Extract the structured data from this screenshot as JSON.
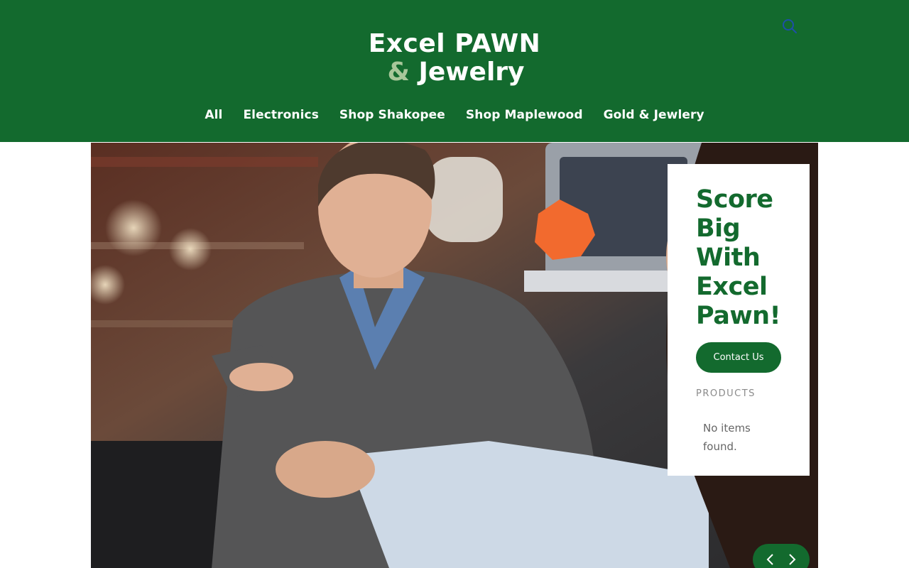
{
  "brand": {
    "logo_line1": "Excel PAWN",
    "logo_amp": "&",
    "logo_line2": "Jewelry",
    "primary_color": "#136a2e",
    "accent_color": "#a8c79a"
  },
  "header": {
    "search_icon": "search-icon"
  },
  "nav": {
    "items": [
      {
        "label": "All"
      },
      {
        "label": "Electronics"
      },
      {
        "label": "Shop Shakopee"
      },
      {
        "label": "Shop Maplewood"
      },
      {
        "label": "Gold & Jewlery"
      }
    ]
  },
  "hero": {
    "image": "photo of a man at a pawn shop counter being helped by a woman",
    "card": {
      "title": "Score Big With Excel Pawn!",
      "button_label": "Contact Us",
      "products_label": "PRODUCTS",
      "empty_text": "No items found."
    },
    "carousel": {
      "prev_icon": "chevron-left-icon",
      "next_icon": "chevron-right-icon"
    }
  }
}
